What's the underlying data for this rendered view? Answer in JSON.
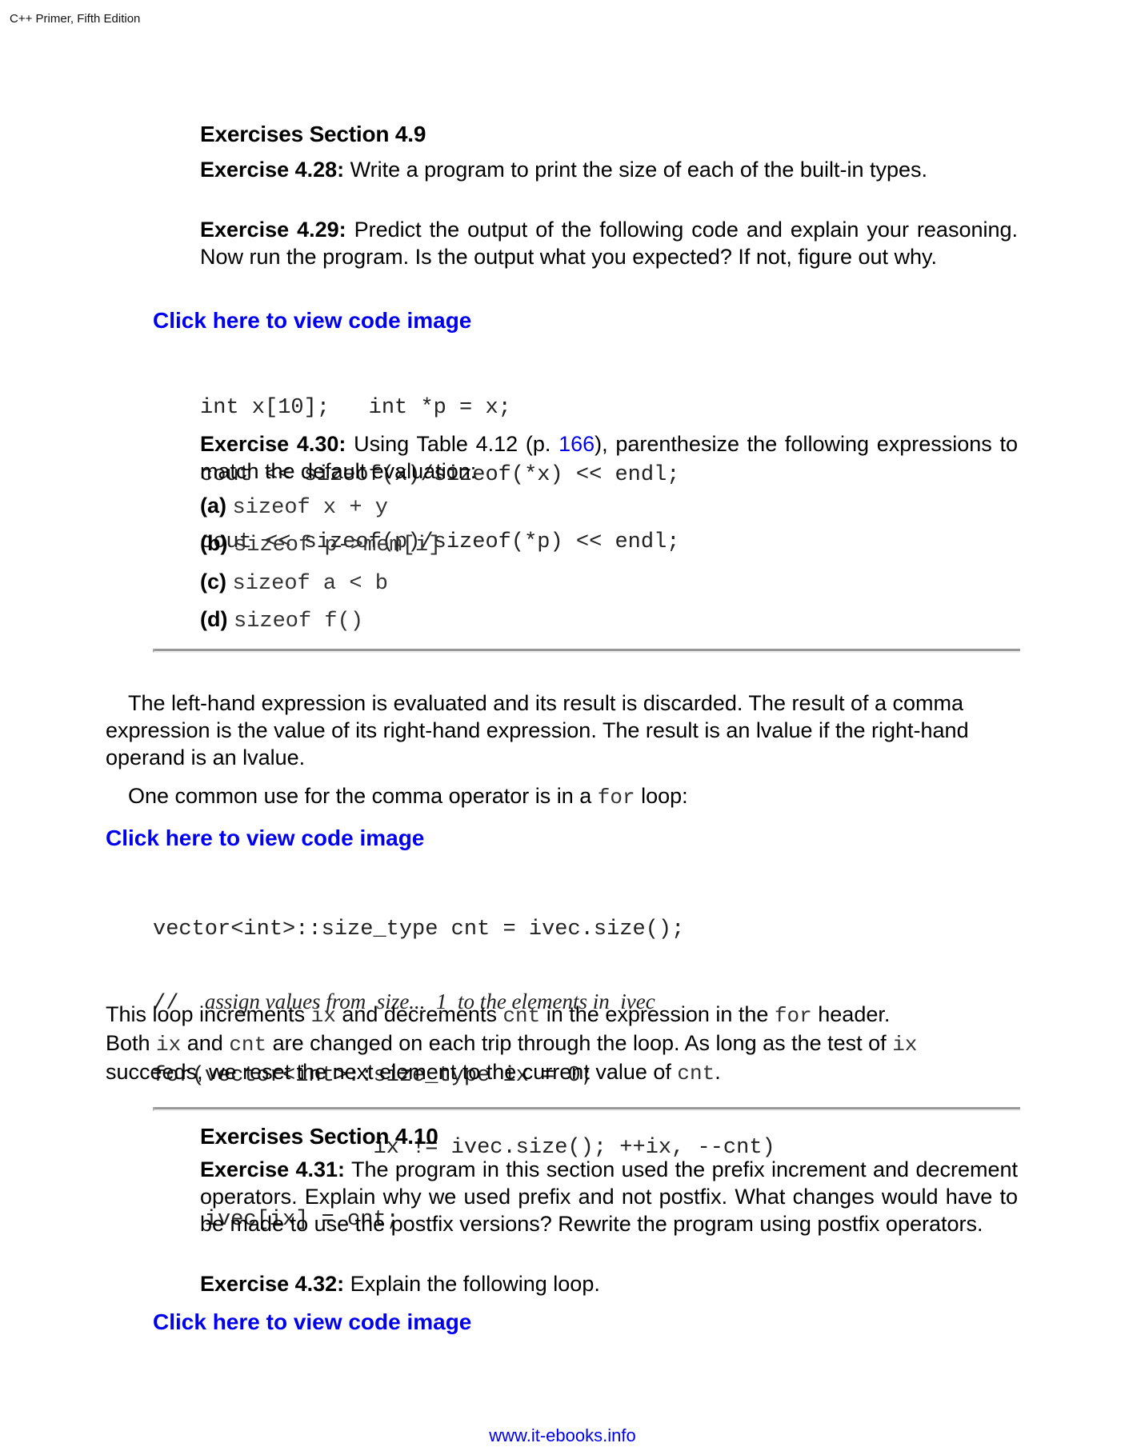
{
  "header": {
    "book_title": "C++ Primer, Fifth Edition"
  },
  "section_49": {
    "title": "Exercises Section 4.9",
    "ex428": {
      "label": "Exercise 4.28:",
      "text": " Write a program to print the size of each of the built-in types."
    },
    "ex429": {
      "label": "Exercise 4.29:",
      "text": " Predict the output of the following code and explain your reasoning. Now run the program. Is the output what you expected? If not, figure out why."
    },
    "code_link": "Click here to view code image",
    "code": [
      "int x[10];   int *p = x;",
      "cout << sizeof(x)/sizeof(*x) << endl;",
      "cout << sizeof(p)/sizeof(*p) << endl;"
    ],
    "ex430": {
      "label": "Exercise 4.30:",
      "text_before": " Using Table 4.12 (p. ",
      "page_link": "166",
      "text_after": "), parenthesize the following expressions to match the default evaluation:",
      "items": [
        {
          "label": "(a)",
          "code": "sizeof x + y"
        },
        {
          "label": "(b)",
          "code": "sizeof p->mem[i]"
        },
        {
          "label": "(c)",
          "code": "sizeof a < b"
        },
        {
          "label": "(d)",
          "code": "sizeof f()"
        }
      ]
    }
  },
  "body": {
    "para1": "The left-hand expression is evaluated and its result is discarded. The result of a comma expression is the value of its right-hand expression. The result is an lvalue if the right-hand operand is an lvalue.",
    "para2_before": "One common use for the comma operator is in a ",
    "para2_code": "for",
    "para2_after": " loop:",
    "code_link": "Click here to view code image",
    "code_line1": "vector<int>::size_type cnt = ivec.size();",
    "code_comment_slashes": "//",
    "code_comment": "assign values from  size...  1  to the elements in  ivec",
    "code_line3": "for(vector<int>::size_type ix = 0;",
    "code_line4": "                 ix != ivec.size(); ++ix, --cnt)",
    "code_line5": "    ivec[ix] = cnt;",
    "para3": {
      "t1": "This loop increments ",
      "c1": "ix",
      "t2": " and decrements ",
      "c2": "cnt",
      "t3": " in the expression in the ",
      "c3": "for",
      "t4": " header.",
      "t5": "Both ",
      "c4": "ix",
      "t6": " and ",
      "c5": "cnt",
      "t7": " are changed on each trip through the loop. As long as the test of ",
      "c6": "ix",
      "t8": "succeeds, we reset the next element to the current value of ",
      "c7": "cnt",
      "t9": "."
    }
  },
  "section_410": {
    "title": "Exercises Section 4.10",
    "ex431": {
      "label": "Exercise 4.31:",
      "text": " The program in this section used the prefix increment and decrement operators. Explain why we used prefix and not postfix. What changes would have to be made to use the postfix versions? Rewrite the program using postfix operators."
    },
    "ex432": {
      "label": "Exercise 4.32:",
      "text": " Explain the following loop."
    },
    "code_link": "Click here to view code image"
  },
  "footer": {
    "site": "www.it-ebooks.info"
  }
}
